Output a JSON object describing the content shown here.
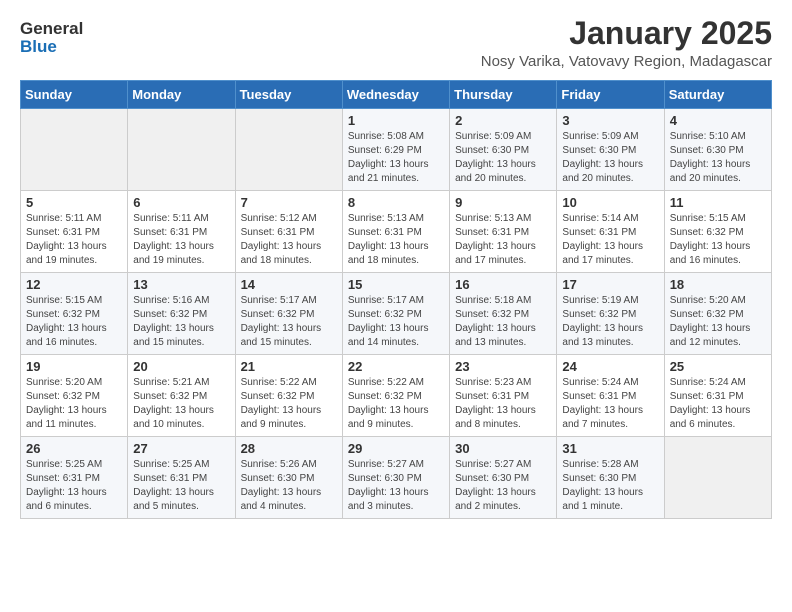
{
  "logo": {
    "general": "General",
    "blue": "Blue"
  },
  "header": {
    "title": "January 2025",
    "subtitle": "Nosy Varika, Vatovavy Region, Madagascar"
  },
  "weekdays": [
    "Sunday",
    "Monday",
    "Tuesday",
    "Wednesday",
    "Thursday",
    "Friday",
    "Saturday"
  ],
  "weeks": [
    [
      {
        "day": "",
        "detail": ""
      },
      {
        "day": "",
        "detail": ""
      },
      {
        "day": "",
        "detail": ""
      },
      {
        "day": "1",
        "detail": "Sunrise: 5:08 AM\nSunset: 6:29 PM\nDaylight: 13 hours\nand 21 minutes."
      },
      {
        "day": "2",
        "detail": "Sunrise: 5:09 AM\nSunset: 6:30 PM\nDaylight: 13 hours\nand 20 minutes."
      },
      {
        "day": "3",
        "detail": "Sunrise: 5:09 AM\nSunset: 6:30 PM\nDaylight: 13 hours\nand 20 minutes."
      },
      {
        "day": "4",
        "detail": "Sunrise: 5:10 AM\nSunset: 6:30 PM\nDaylight: 13 hours\nand 20 minutes."
      }
    ],
    [
      {
        "day": "5",
        "detail": "Sunrise: 5:11 AM\nSunset: 6:31 PM\nDaylight: 13 hours\nand 19 minutes."
      },
      {
        "day": "6",
        "detail": "Sunrise: 5:11 AM\nSunset: 6:31 PM\nDaylight: 13 hours\nand 19 minutes."
      },
      {
        "day": "7",
        "detail": "Sunrise: 5:12 AM\nSunset: 6:31 PM\nDaylight: 13 hours\nand 18 minutes."
      },
      {
        "day": "8",
        "detail": "Sunrise: 5:13 AM\nSunset: 6:31 PM\nDaylight: 13 hours\nand 18 minutes."
      },
      {
        "day": "9",
        "detail": "Sunrise: 5:13 AM\nSunset: 6:31 PM\nDaylight: 13 hours\nand 17 minutes."
      },
      {
        "day": "10",
        "detail": "Sunrise: 5:14 AM\nSunset: 6:31 PM\nDaylight: 13 hours\nand 17 minutes."
      },
      {
        "day": "11",
        "detail": "Sunrise: 5:15 AM\nSunset: 6:32 PM\nDaylight: 13 hours\nand 16 minutes."
      }
    ],
    [
      {
        "day": "12",
        "detail": "Sunrise: 5:15 AM\nSunset: 6:32 PM\nDaylight: 13 hours\nand 16 minutes."
      },
      {
        "day": "13",
        "detail": "Sunrise: 5:16 AM\nSunset: 6:32 PM\nDaylight: 13 hours\nand 15 minutes."
      },
      {
        "day": "14",
        "detail": "Sunrise: 5:17 AM\nSunset: 6:32 PM\nDaylight: 13 hours\nand 15 minutes."
      },
      {
        "day": "15",
        "detail": "Sunrise: 5:17 AM\nSunset: 6:32 PM\nDaylight: 13 hours\nand 14 minutes."
      },
      {
        "day": "16",
        "detail": "Sunrise: 5:18 AM\nSunset: 6:32 PM\nDaylight: 13 hours\nand 13 minutes."
      },
      {
        "day": "17",
        "detail": "Sunrise: 5:19 AM\nSunset: 6:32 PM\nDaylight: 13 hours\nand 13 minutes."
      },
      {
        "day": "18",
        "detail": "Sunrise: 5:20 AM\nSunset: 6:32 PM\nDaylight: 13 hours\nand 12 minutes."
      }
    ],
    [
      {
        "day": "19",
        "detail": "Sunrise: 5:20 AM\nSunset: 6:32 PM\nDaylight: 13 hours\nand 11 minutes."
      },
      {
        "day": "20",
        "detail": "Sunrise: 5:21 AM\nSunset: 6:32 PM\nDaylight: 13 hours\nand 10 minutes."
      },
      {
        "day": "21",
        "detail": "Sunrise: 5:22 AM\nSunset: 6:32 PM\nDaylight: 13 hours\nand 9 minutes."
      },
      {
        "day": "22",
        "detail": "Sunrise: 5:22 AM\nSunset: 6:32 PM\nDaylight: 13 hours\nand 9 minutes."
      },
      {
        "day": "23",
        "detail": "Sunrise: 5:23 AM\nSunset: 6:31 PM\nDaylight: 13 hours\nand 8 minutes."
      },
      {
        "day": "24",
        "detail": "Sunrise: 5:24 AM\nSunset: 6:31 PM\nDaylight: 13 hours\nand 7 minutes."
      },
      {
        "day": "25",
        "detail": "Sunrise: 5:24 AM\nSunset: 6:31 PM\nDaylight: 13 hours\nand 6 minutes."
      }
    ],
    [
      {
        "day": "26",
        "detail": "Sunrise: 5:25 AM\nSunset: 6:31 PM\nDaylight: 13 hours\nand 6 minutes."
      },
      {
        "day": "27",
        "detail": "Sunrise: 5:25 AM\nSunset: 6:31 PM\nDaylight: 13 hours\nand 5 minutes."
      },
      {
        "day": "28",
        "detail": "Sunrise: 5:26 AM\nSunset: 6:30 PM\nDaylight: 13 hours\nand 4 minutes."
      },
      {
        "day": "29",
        "detail": "Sunrise: 5:27 AM\nSunset: 6:30 PM\nDaylight: 13 hours\nand 3 minutes."
      },
      {
        "day": "30",
        "detail": "Sunrise: 5:27 AM\nSunset: 6:30 PM\nDaylight: 13 hours\nand 2 minutes."
      },
      {
        "day": "31",
        "detail": "Sunrise: 5:28 AM\nSunset: 6:30 PM\nDaylight: 13 hours\nand 1 minute."
      },
      {
        "day": "",
        "detail": ""
      }
    ]
  ]
}
